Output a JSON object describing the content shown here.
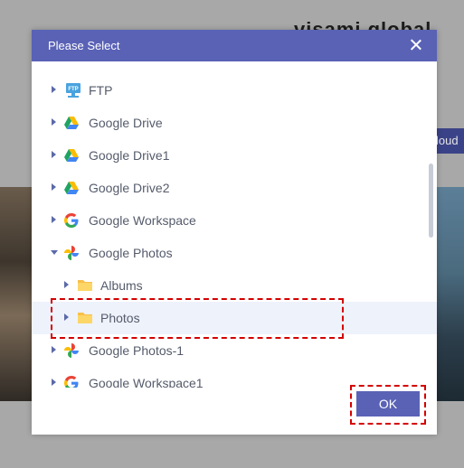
{
  "background": {
    "title": "visami global",
    "cloud_tab": "loud"
  },
  "dialog": {
    "title": "Please Select",
    "ok_label": "OK"
  },
  "tree": [
    {
      "label": "FTP",
      "icon": "ftp-icon",
      "expanded": false,
      "selected": false
    },
    {
      "label": "Google Drive",
      "icon": "google-drive-icon",
      "expanded": false,
      "selected": false
    },
    {
      "label": "Google Drive1",
      "icon": "google-drive-icon",
      "expanded": false,
      "selected": false
    },
    {
      "label": "Google Drive2",
      "icon": "google-drive-icon",
      "expanded": false,
      "selected": false
    },
    {
      "label": "Google Workspace",
      "icon": "google-icon",
      "expanded": false,
      "selected": false
    },
    {
      "label": "Google Photos",
      "icon": "google-photos-icon",
      "expanded": true,
      "selected": false
    },
    {
      "label": "Albums",
      "icon": "folder-icon",
      "expanded": false,
      "selected": false
    },
    {
      "label": "Photos",
      "icon": "folder-icon",
      "expanded": false,
      "selected": true
    },
    {
      "label": "Google Photos-1",
      "icon": "google-photos-icon",
      "expanded": false,
      "selected": false
    },
    {
      "label": "Google Workspace1",
      "icon": "google-icon",
      "expanded": false,
      "selected": false
    }
  ],
  "colors": {
    "accent": "#5a62b6",
    "highlight": "#d40000",
    "selected_row": "#eef2fb"
  }
}
